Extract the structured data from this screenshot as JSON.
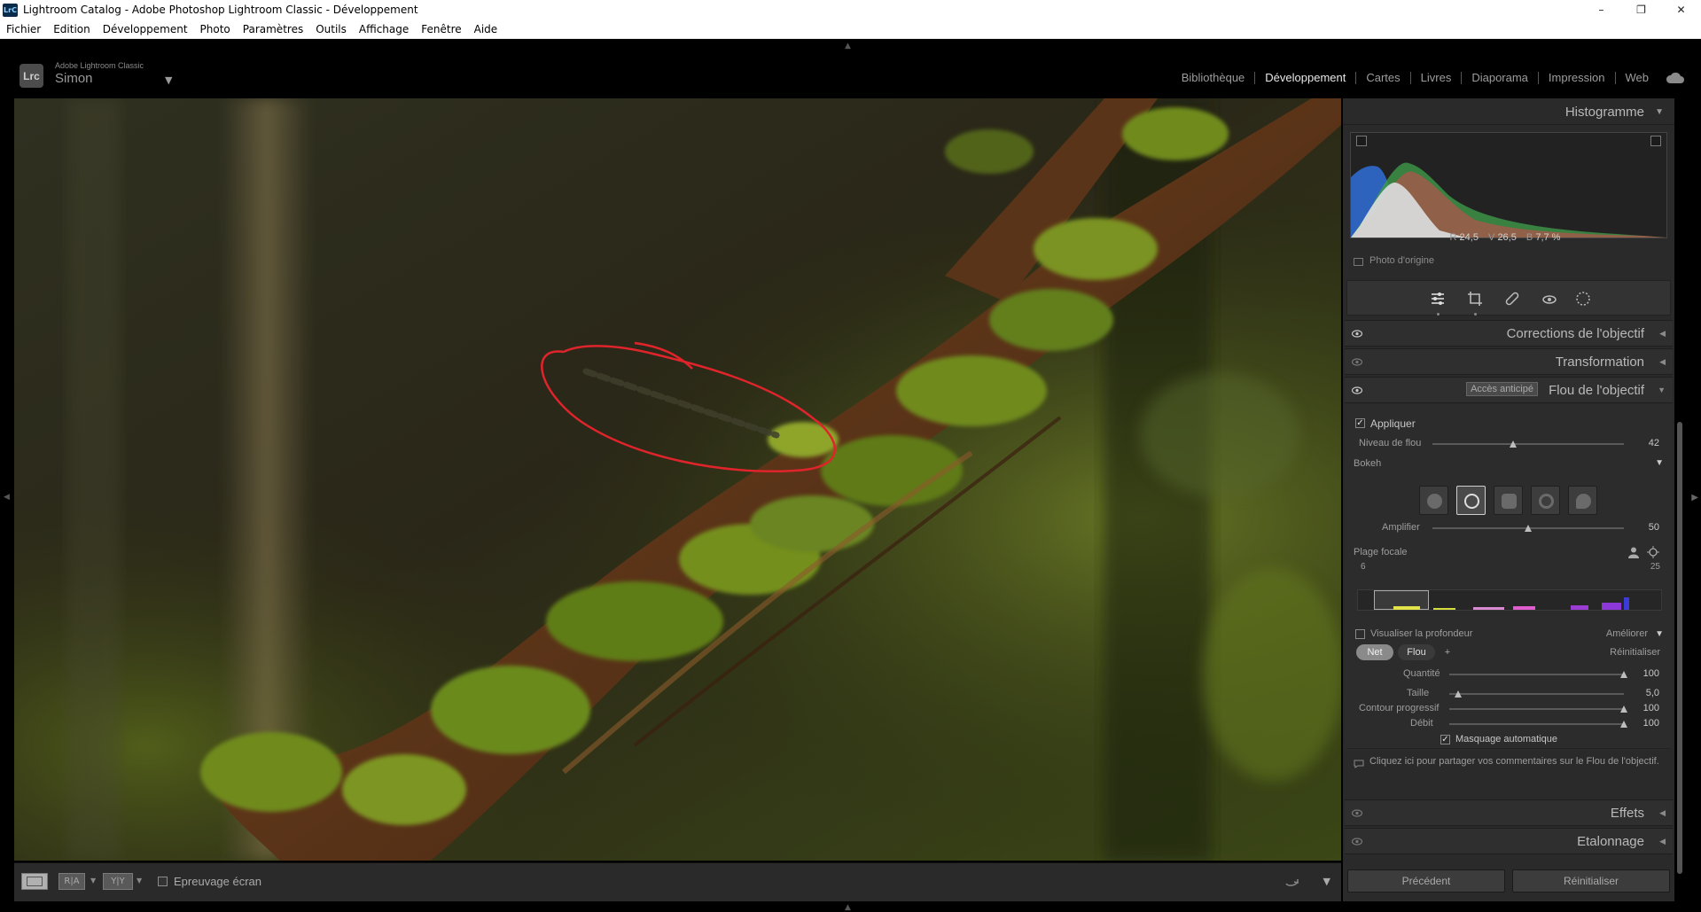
{
  "window": {
    "title": "Lightroom Catalog - Adobe Photoshop Lightroom Classic - Développement",
    "app_icon_text": "LrC",
    "controls": [
      "–",
      "❐",
      "✕"
    ]
  },
  "menu": [
    "Fichier",
    "Edition",
    "Développement",
    "Photo",
    "Paramètres",
    "Outils",
    "Affichage",
    "Fenêtre",
    "Aide"
  ],
  "identity": {
    "logo": "Lrc",
    "product": "Adobe Lightroom Classic",
    "user": "Simon"
  },
  "modules": [
    {
      "label": "Bibliothèque",
      "active": false
    },
    {
      "label": "Développement",
      "active": true
    },
    {
      "label": "Cartes",
      "active": false
    },
    {
      "label": "Livres",
      "active": false
    },
    {
      "label": "Diaporama",
      "active": false
    },
    {
      "label": "Impression",
      "active": false
    },
    {
      "label": "Web",
      "active": false
    }
  ],
  "toolbar": {
    "view_loupe": "",
    "view_compare": "R|A",
    "view_survey": "Y|Y",
    "softproof_label": "Epreuvage écran"
  },
  "histogram": {
    "title": "Histogramme",
    "r_label": "R",
    "r_value": "24,5",
    "v_label": "V",
    "v_value": "26,5",
    "b_label": "B",
    "b_value": "7,7 %",
    "original_photo_label": "Photo d'origine"
  },
  "sections": {
    "lens_corrections": "Corrections de l'objectif",
    "transformation": "Transformation",
    "lens_blur": "Flou de l'objectif",
    "preview_badge": "Accès anticipé",
    "effects": "Effets",
    "grading": "Etalonnage"
  },
  "lens_blur": {
    "apply_label": "Appliquer",
    "blur_level_label": "Niveau de flou",
    "blur_level_value": "42",
    "blur_level_fraction": 0.42,
    "bokeh_label": "Bokeh",
    "boost_label": "Amplifier",
    "boost_value": "50",
    "boost_fraction": 0.5,
    "focal_range_label": "Plage focale",
    "focal_min": "6",
    "focal_max": "25",
    "visualize_depth_label": "Visualiser la profondeur",
    "refine_label": "Améliorer",
    "chip_sharp": "Net",
    "chip_blur": "Flou",
    "chip_add": "+",
    "reset_small": "Réinitialiser",
    "amount_label": "Quantité",
    "amount_value": "100",
    "amount_fraction": 1.0,
    "size_label": "Taille",
    "size_value": "5,0",
    "size_fraction": 0.05,
    "feather_label": "Contour progressif",
    "feather_value": "100",
    "feather_fraction": 1.0,
    "flow_label": "Débit",
    "flow_value": "100",
    "flow_fraction": 1.0,
    "auto_mask_label": "Masquage automatique",
    "feedback_text": "Cliquez ici pour partager vos commentaires sur le Flou de l'objectif."
  },
  "footer": {
    "previous_label": "Précédent",
    "reset_label": "Réinitialiser"
  },
  "colors": {
    "annotation_red": "#e0242b",
    "moss_green": "#6f8a1e",
    "bark_brown": "#5a3a1f"
  }
}
